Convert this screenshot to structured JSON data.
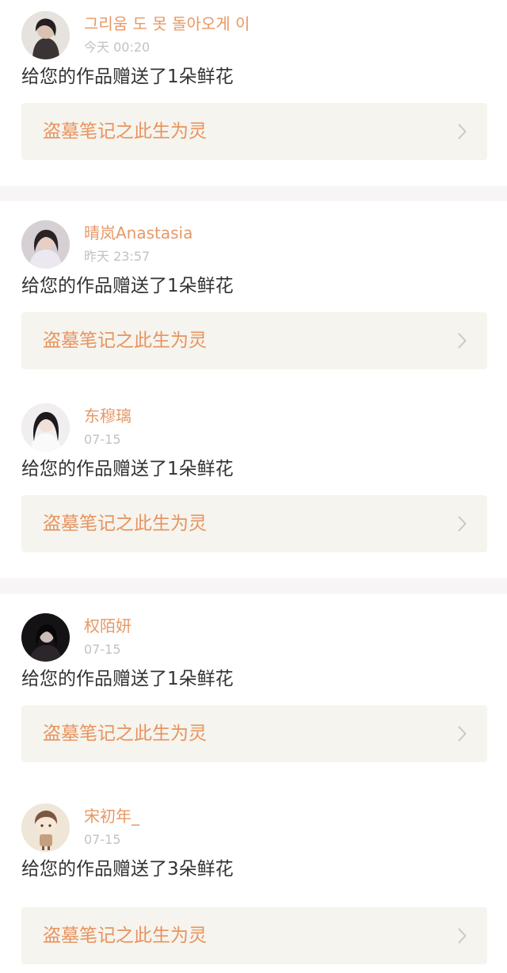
{
  "notifications": [
    {
      "user": "그리움 도 못 돌아오게 이",
      "time": "今天 00:20",
      "message": "给您的作品赠送了1朵鲜花",
      "work_title": "盗墓笔记之此生为灵",
      "avatar_icon": "user-avatar-photo"
    },
    {
      "user": "晴岚Anastasia",
      "time": "昨天 23:57",
      "message": "给您的作品赠送了1朵鲜花",
      "work_title": "盗墓笔记之此生为灵",
      "avatar_icon": "user-avatar-photo"
    },
    {
      "user": "东穆璃",
      "time": "07-15",
      "message": "给您的作品赠送了1朵鲜花",
      "work_title": "盗墓笔记之此生为灵",
      "avatar_icon": "user-avatar-photo"
    },
    {
      "user": "权陌妍",
      "time": "07-15",
      "message": "给您的作品赠送了1朵鲜花",
      "work_title": "盗墓笔记之此生为灵",
      "avatar_icon": "user-avatar-photo"
    },
    {
      "user": "宋初年_",
      "time": "07-15",
      "message": "给您的作品赠送了3朵鲜花",
      "work_title": "盗墓笔记之此生为灵",
      "avatar_icon": "user-avatar-illustration"
    }
  ],
  "colors": {
    "username": "#e79866",
    "timestamp": "#c2c2c2",
    "message_text": "#333333",
    "work_card_bg": "#f5f4ee",
    "work_title": "#e8935e",
    "separator": "#f7f5f5",
    "chevron": "#c8c8c8"
  },
  "icons": {
    "work_chevron": "chevron-right-icon"
  }
}
